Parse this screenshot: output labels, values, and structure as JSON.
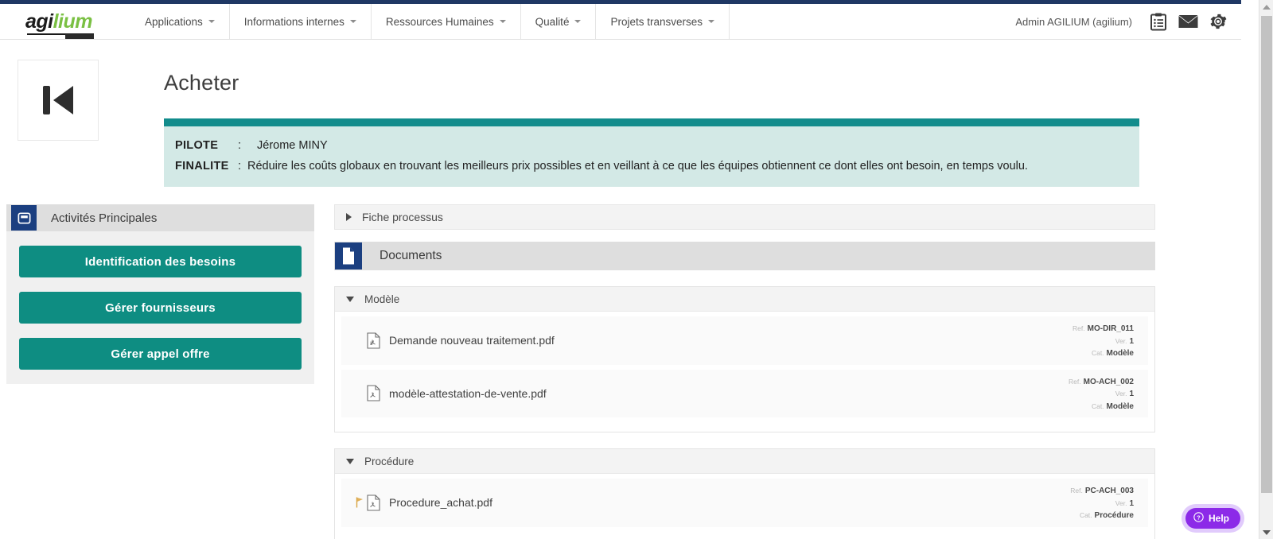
{
  "brand": {
    "logo_part1": "agi",
    "logo_part2": "lium"
  },
  "nav": {
    "items": [
      {
        "label": "Applications",
        "icon": "chevron-down-icon"
      },
      {
        "label": "Informations internes",
        "icon": "chevron-down-icon"
      },
      {
        "label": "Ressources Humaines",
        "icon": "chevron-down-icon"
      },
      {
        "label": "Qualité",
        "icon": "chevron-down-icon"
      },
      {
        "label": "Projets transverses",
        "icon": "chevron-down-icon"
      }
    ],
    "user": "Admin AGILIUM (agilium)",
    "icons": [
      "clipboard-icon",
      "envelope-icon",
      "gear-icon"
    ]
  },
  "process": {
    "icon": "skip-to-start-icon",
    "title": "Acheter",
    "accent_color": "#128c8c",
    "info_bg": "#d3e9e6",
    "pilote_label": "PILOTE",
    "pilote_colon": ":",
    "pilote_value": "Jérome MINY",
    "finalite_label": "FINALITE",
    "finalite_colon": ":",
    "finalite_value": "Réduire les coûts globaux en trouvant les meilleurs prix possibles et en veillant à ce que les équipes obtiennent ce dont elles ont besoin, en temps voulu."
  },
  "left_panel": {
    "icon": "form-window-icon",
    "title": "Activités Principales",
    "button_color": "#0e8d82",
    "buttons": [
      {
        "label": "Identification des besoins"
      },
      {
        "label": "Gérer fournisseurs"
      },
      {
        "label": "Gérer appel offre"
      }
    ]
  },
  "right_panel": {
    "fiche": {
      "label": "Fiche processus",
      "icon": "triangle-right-icon",
      "expanded": false
    },
    "documents_header": {
      "icon": "document-page-icon",
      "title": "Documents"
    },
    "groups": [
      {
        "title": "Modèle",
        "icon": "triangle-down-icon",
        "expanded": true,
        "documents": [
          {
            "flag": "",
            "icon": "pdf-file-icon",
            "name": "Demande nouveau traitement.pdf",
            "ref_label": "Ref.",
            "ref_value": "MO-DIR_011",
            "ver_label": "Ver.",
            "ver_value": "1",
            "cat_label": "Cat.",
            "cat_value": "Modèle"
          },
          {
            "flag": "",
            "icon": "pdf-file-icon",
            "name": "modèle-attestation-de-vente.pdf",
            "ref_label": "Ref.",
            "ref_value": "MO-ACH_002",
            "ver_label": "Ver.",
            "ver_value": "1",
            "cat_label": "Cat.",
            "cat_value": "Modèle"
          }
        ]
      },
      {
        "title": "Procédure",
        "icon": "triangle-down-icon",
        "expanded": true,
        "documents": [
          {
            "flag": "flag-icon",
            "icon": "pdf-file-icon",
            "name": "Procedure_achat.pdf",
            "ref_label": "Ref.",
            "ref_value": "PC-ACH_003",
            "ver_label": "Ver.",
            "ver_value": "1",
            "cat_label": "Cat.",
            "cat_value": "Procédure"
          }
        ]
      }
    ]
  },
  "help": {
    "label": "Help",
    "icon": "question-circle-icon",
    "color": "#8c2ae8"
  },
  "scrollbar": {
    "up_icon": "scroll-up-arrow-icon",
    "down_icon": "scroll-down-arrow-icon"
  }
}
